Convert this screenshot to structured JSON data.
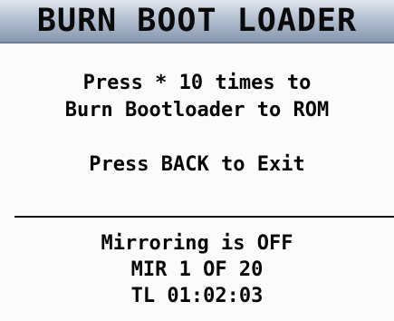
{
  "header": {
    "title": "BURN BOOT LOADER"
  },
  "instructions": {
    "line1": "Press * 10 times to",
    "line2": "Burn Bootloader to ROM",
    "exit": "Press BACK to Exit"
  },
  "status": {
    "mirroring": "Mirroring is OFF",
    "mir_index": "MIR 1 OF 20",
    "timer": "TL 01:02:03"
  },
  "colors": {
    "title_bar_top": "#dfe6ef",
    "title_bar_bottom": "#8797ad",
    "background": "#fbfbfb",
    "text": "#050505"
  }
}
